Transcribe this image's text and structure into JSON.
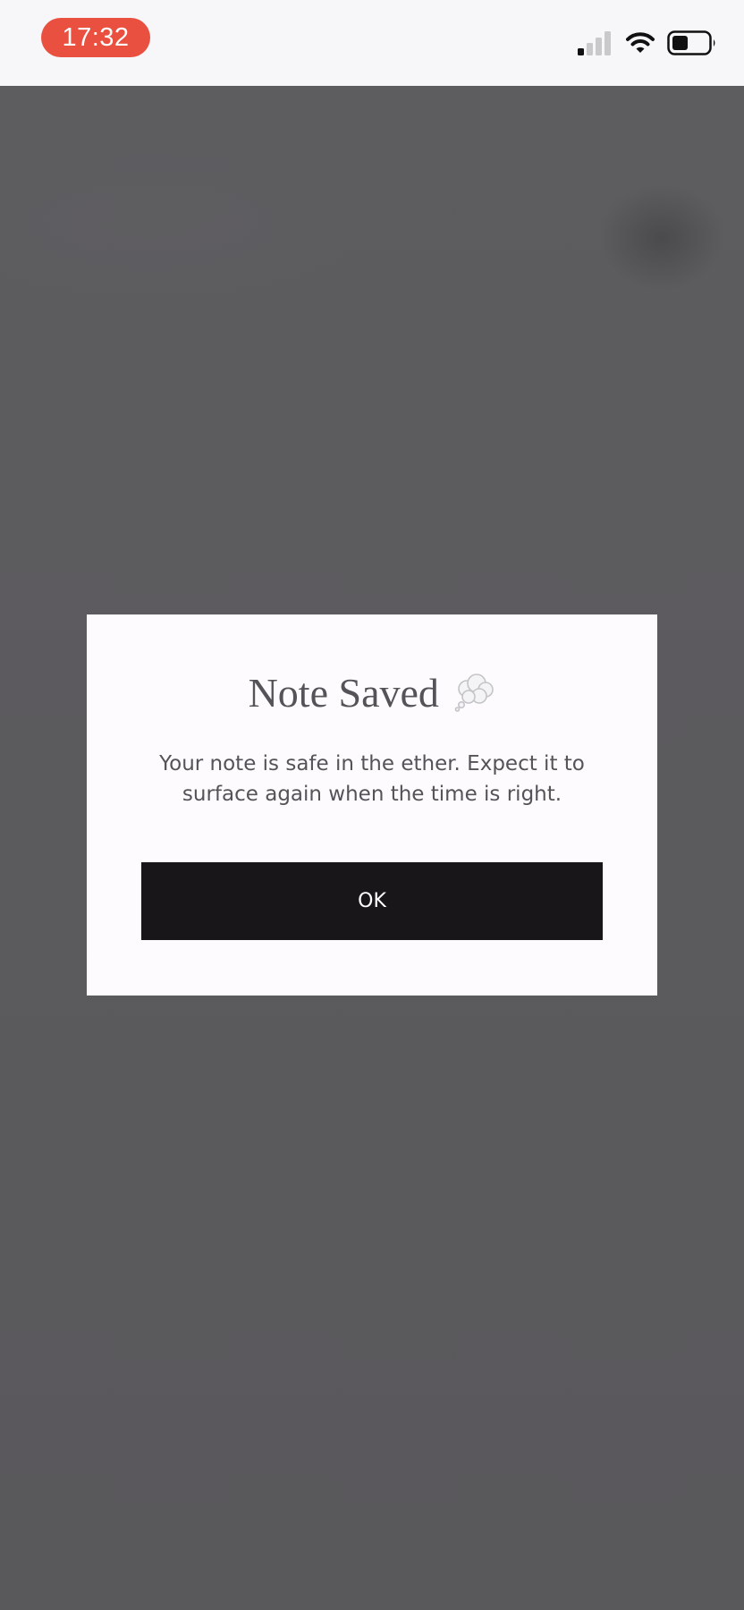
{
  "status_bar": {
    "time": "17:32",
    "time_pill_color": "#e9503f",
    "icons": [
      "signal-icon",
      "wifi-icon",
      "battery-icon"
    ]
  },
  "modal": {
    "title": "Note Saved",
    "title_icon": "thought-balloon-icon",
    "message": "Your note is safe in the ether. Expect it to surface again when the time is right.",
    "ok_label": "OK",
    "button_color": "#181619"
  }
}
